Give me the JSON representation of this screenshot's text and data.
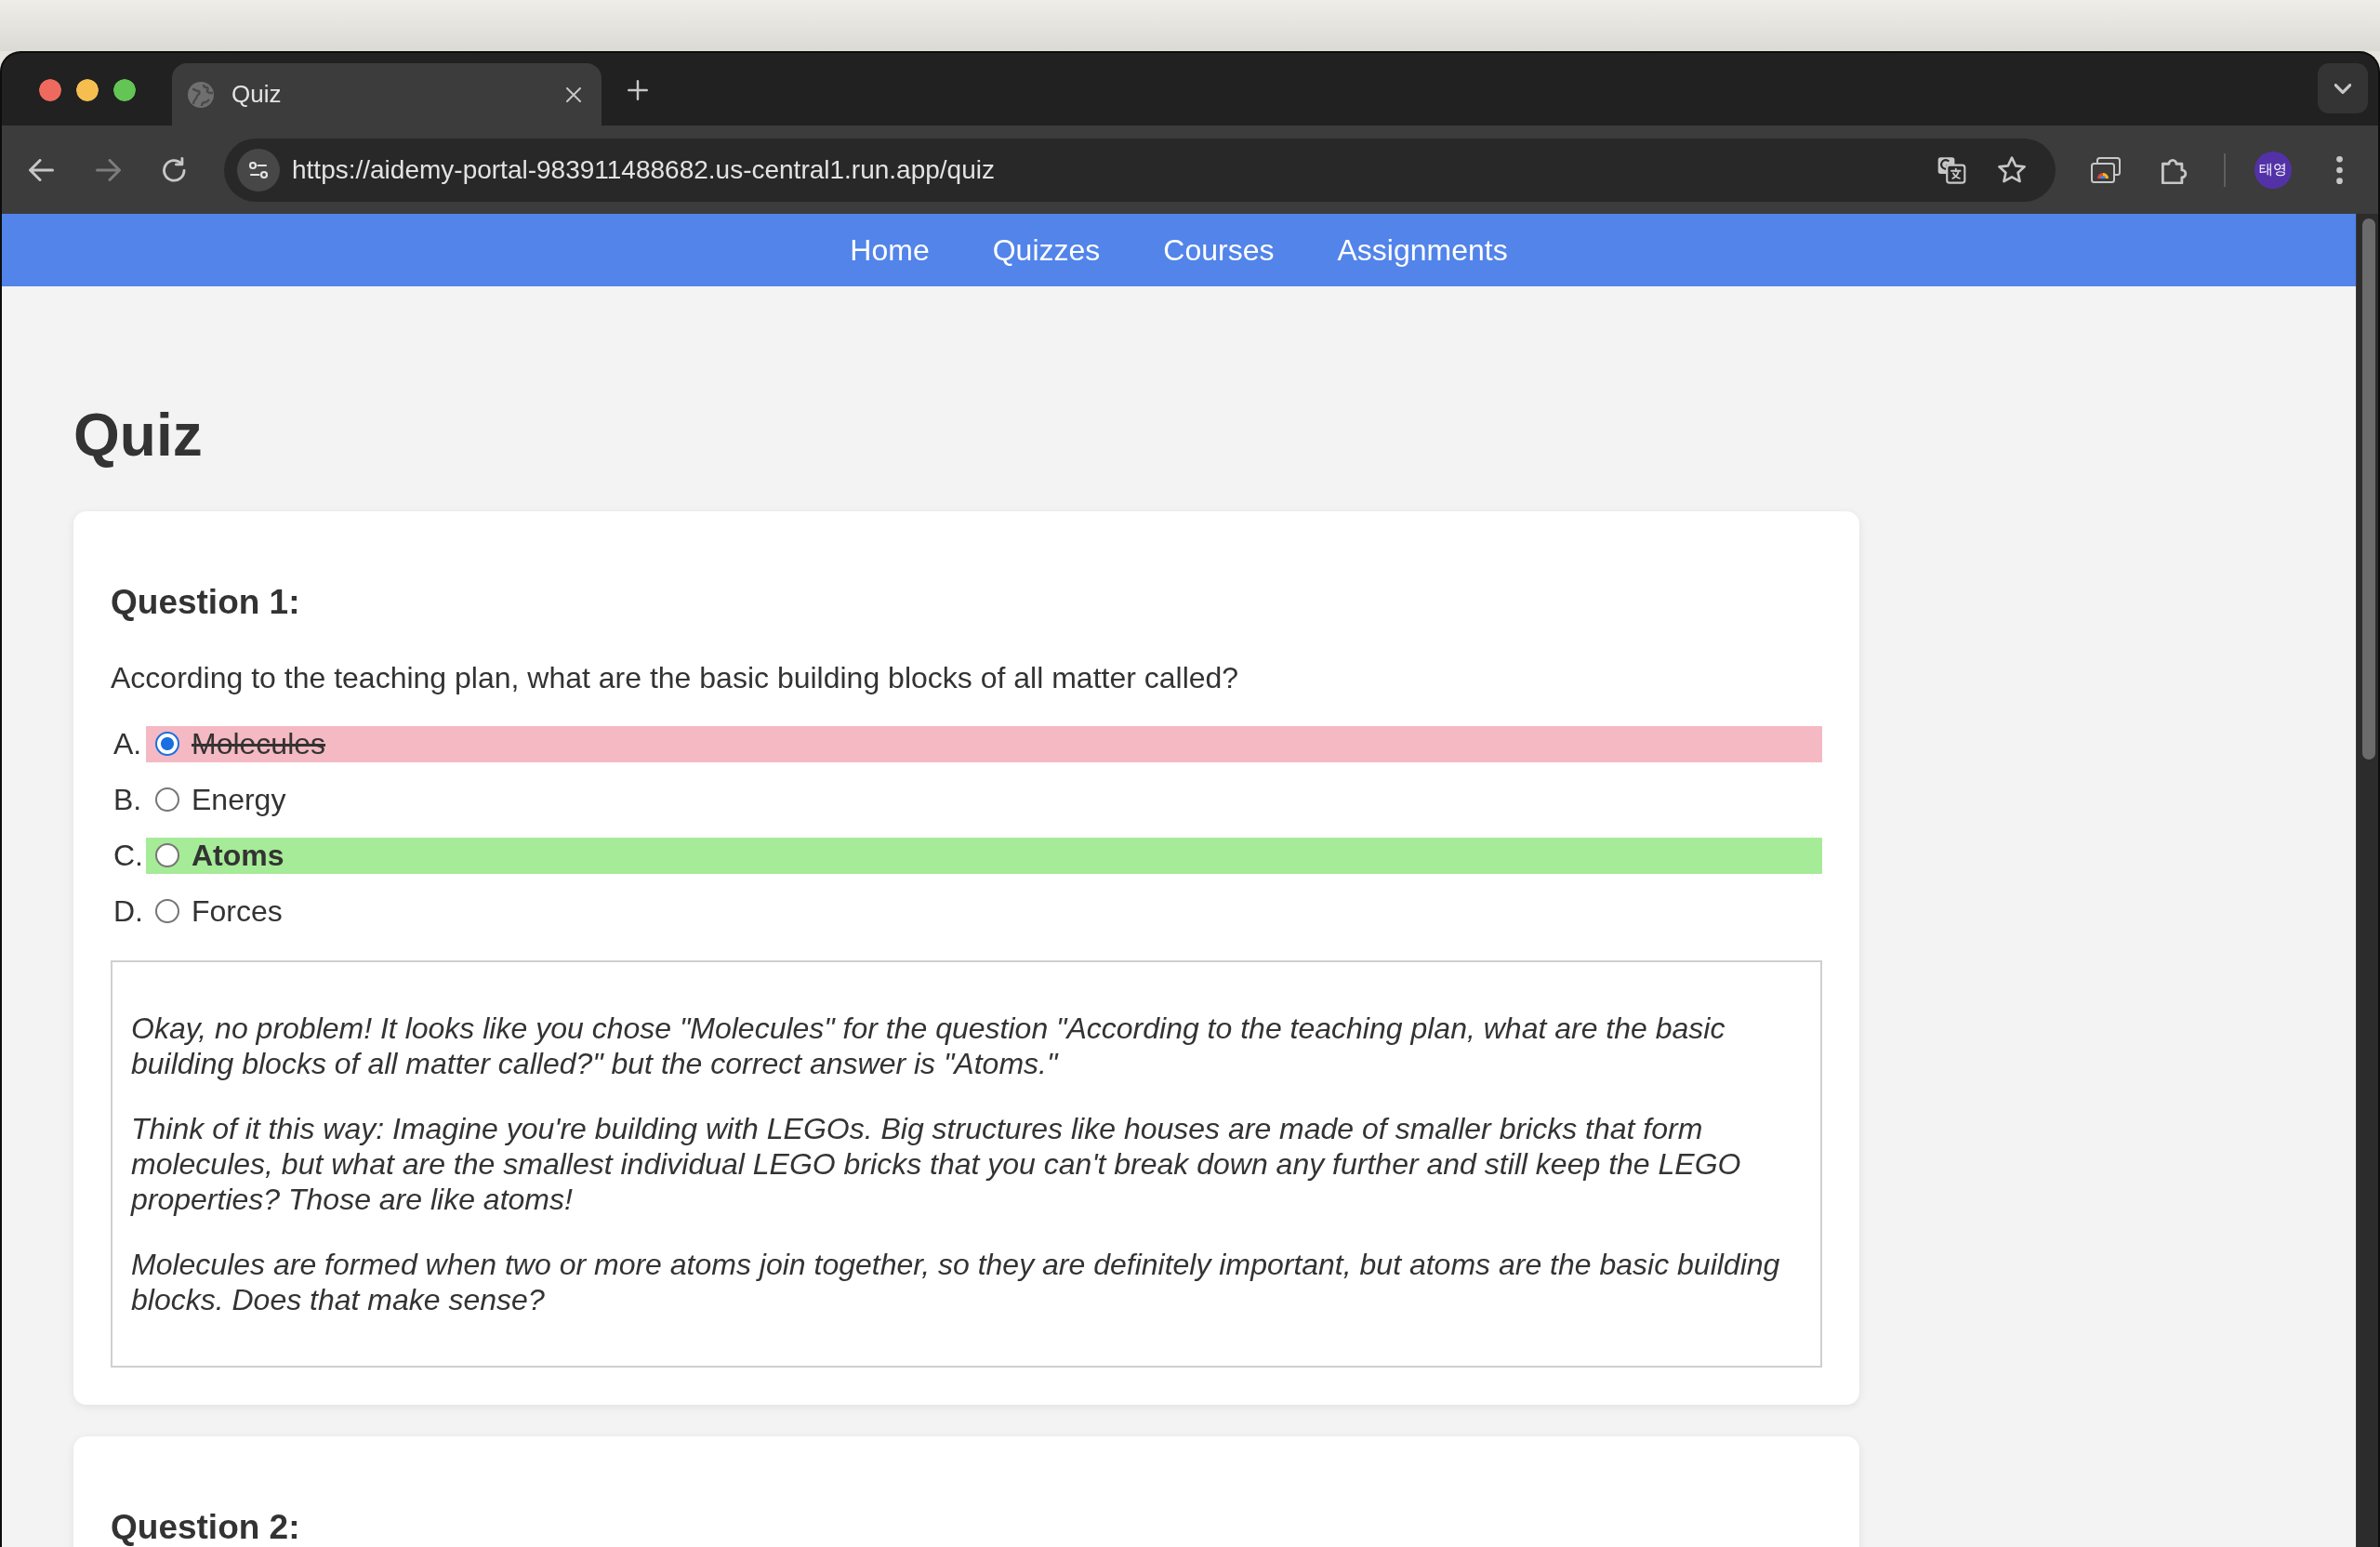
{
  "browser": {
    "tabs": [
      {
        "title": "Quiz",
        "selected": true
      }
    ],
    "nav_buttons": [
      {
        "kind": "back",
        "disabled": false
      },
      {
        "kind": "forward",
        "disabled": true
      },
      {
        "kind": "reload",
        "disabled": false
      }
    ],
    "address": "https://aidemy-portal-983911488682.us-central1.run.app/quiz",
    "profile": "태영"
  },
  "nav": {
    "links": [
      {
        "label": "Home"
      },
      {
        "label": "Quizzes"
      },
      {
        "label": "Courses"
      },
      {
        "label": "Assignments"
      }
    ]
  },
  "page": {
    "title": "Quiz"
  },
  "questions": [
    {
      "heading": "Question 1:",
      "text": "According to the teaching plan, what are the basic building blocks of all matter called?",
      "options": [
        {
          "letter": "A.",
          "label": "Molecules",
          "selected": true,
          "correct": false,
          "incorrect": true
        },
        {
          "letter": "B.",
          "label": "Energy",
          "selected": false,
          "correct": false,
          "incorrect": false
        },
        {
          "letter": "C.",
          "label": "Atoms",
          "selected": false,
          "correct": true,
          "incorrect": false
        },
        {
          "letter": "D.",
          "label": "Forces",
          "selected": false,
          "correct": false,
          "incorrect": false
        }
      ],
      "feedback": [
        "Okay, no problem! It looks like you chose \"Molecules\" for the question \"According to the teaching plan, what are the basic building blocks of all matter called?\" but the correct answer is \"Atoms.\"",
        "Think of it this way: Imagine you're building with LEGOs. Big structures like houses are made of smaller bricks that form molecules, but what are the smallest individual LEGO bricks that you can't break down any further and still keep the LEGO properties? Those are like atoms!",
        "Molecules are formed when two or more atoms join together, so they are definitely important, but atoms are the basic building blocks. Does that make sense?"
      ]
    },
    {
      "heading": "Question 2:"
    }
  ]
}
